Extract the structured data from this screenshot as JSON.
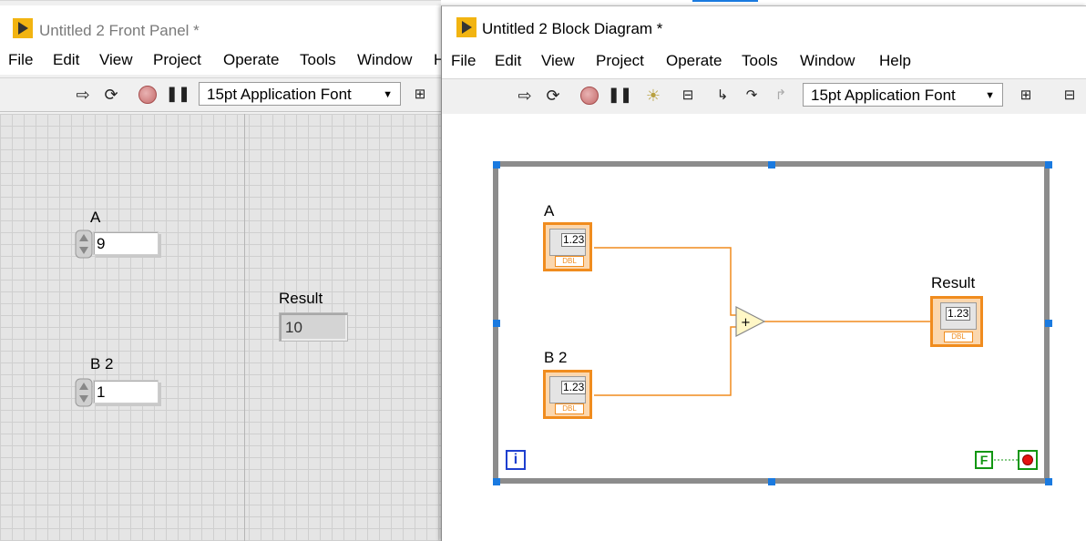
{
  "front_panel": {
    "title": "Untitled 2 Front Panel *",
    "menu": [
      "File",
      "Edit",
      "View",
      "Project",
      "Operate",
      "Tools",
      "Window",
      "H"
    ],
    "font_selector": "15pt Application Font",
    "controls": {
      "a": {
        "label": "A",
        "value": "9"
      },
      "b": {
        "label": "B 2",
        "value": "1"
      }
    },
    "indicator": {
      "label": "Result",
      "value": "10"
    }
  },
  "block_diagram": {
    "title": "Untitled 2 Block Diagram *",
    "menu": [
      "File",
      "Edit",
      "View",
      "Project",
      "Operate",
      "Tools",
      "Window",
      "Help"
    ],
    "font_selector": "15pt Application Font",
    "terminals": {
      "a": {
        "label": "A",
        "value": "1.23",
        "type": "DBL"
      },
      "b": {
        "label": "B 2",
        "value": "1.23",
        "type": "DBL"
      },
      "result": {
        "label": "Result",
        "value": "1.23",
        "type": "DBL"
      }
    },
    "add_node": "+",
    "loop_iteration": "i",
    "stop_constant": "F"
  },
  "colors": {
    "wire": "#f08c1e",
    "loop_border": "#8c8c8c",
    "handle": "#1a7ae0",
    "boolean": "#129612",
    "iteration": "#1e3fcf"
  }
}
